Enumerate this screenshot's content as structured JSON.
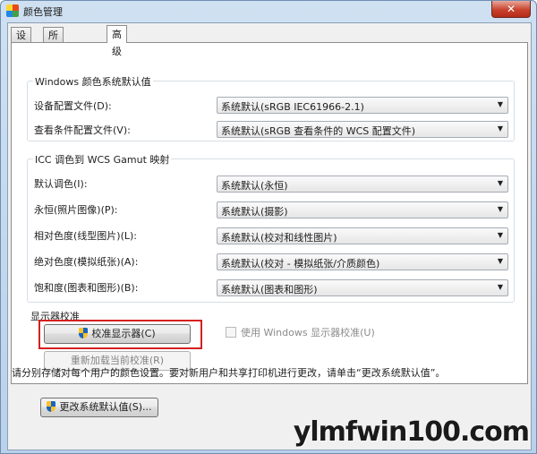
{
  "window": {
    "title": "颜色管理",
    "close_glyph": "✕"
  },
  "tabs": [
    {
      "label": "设备",
      "active": false
    },
    {
      "label": "所有配置文件",
      "active": false
    },
    {
      "label": "高级",
      "active": true
    }
  ],
  "wcs_defaults": {
    "group_label": "Windows 颜色系统默认值",
    "rows": [
      {
        "label": "设备配置文件(D):",
        "value": "系统默认(sRGB IEC61966-2.1)"
      },
      {
        "label": "查看条件配置文件(V):",
        "value": "系统默认(sRGB 查看条件的 WCS 配置文件)"
      }
    ]
  },
  "icc_mapping": {
    "group_label": "ICC 调色到 WCS Gamut 映射",
    "rows": [
      {
        "label": "默认调色(I):",
        "value": "系统默认(永恒)"
      },
      {
        "label": "永恒(照片图像)(P):",
        "value": "系统默认(摄影)"
      },
      {
        "label": "相对色度(线型图片)(L):",
        "value": "系统默认(校对和线性图片)"
      },
      {
        "label": "绝对色度(模拟纸张)(A):",
        "value": "系统默认(校对 - 模拟纸张/介质颜色)"
      },
      {
        "label": "饱和度(图表和图形)(B):",
        "value": "系统默认(图表和图形)"
      }
    ]
  },
  "display_calibration": {
    "group_label": "显示器校准",
    "calibrate_button": "校准显示器(C)",
    "use_windows_calibration": "使用 Windows 显示器校准(U)",
    "use_windows_calibration_checked": false,
    "reload_button": "重新加载当前校准(R)"
  },
  "info_text": "请分别存储对每个用户的颜色设置。要对新用户和共享打印机进行更改，请单击“更改系统默认值”。",
  "change_defaults_button": "更改系统默认值(S)...",
  "combo_arrow": "▼",
  "watermark": "ylmfwin100.com",
  "colors": {
    "highlight": "#d42020",
    "title_bar": "#b9d1ea"
  }
}
